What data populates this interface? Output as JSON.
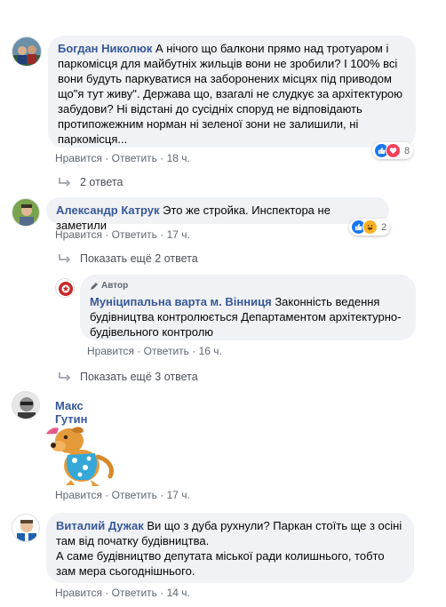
{
  "comments": [
    {
      "author": "Богдан Николюк",
      "text": "А нічого що балкони прямо над тротуаром і паркомісця для майбутніх жильців вони не зробили? І 100% всі вони будуть паркуватися на заборонених місцях під приводом що\"я тут живу\". Держава що, взагалі не слудкує за архітектурою забудови? Ні відстані до сусідніх споруд не відповідають протипожежним норман ні зеленої зони не залишили, ні паркомісця...",
      "like": "Нравится",
      "reply": "Ответить",
      "time": "18 ч.",
      "reaction_count": "8",
      "replies_link": "2 ответа"
    },
    {
      "author": "Александр Катрук",
      "text": "Это же стройка. Инспектора не заметили",
      "like": "Нравится",
      "reply": "Ответить",
      "time": "17 ч.",
      "reaction_count": "2",
      "more_replies": "Показать ещё 2 ответа"
    },
    {
      "author_badge": "Автор",
      "author": "Муніципальна варта м. Вінниця",
      "text": "Законність ведення будівництва контролюється Департаментом архітектурно-будівельного контролю",
      "like": "Нравится",
      "reply": "Ответить",
      "time": "16 ч.",
      "more_replies": "Показать ещё 3 ответа"
    },
    {
      "author": "Макс Гутин",
      "like": "Нравится",
      "reply": "Ответить",
      "time": "17 ч."
    },
    {
      "author": "Виталий Дужак",
      "text_line1": "Ви що з дуба рухнули? Паркан стоїть ще з осіні там від початку будівництва.",
      "text_line2": "А саме будівництво депутата міської ради колишнього, тобто зам мера сьогоднішнього.",
      "like": "Нравится",
      "reply": "Ответить",
      "time": "14 ч."
    }
  ],
  "separator": " · ",
  "colors": {
    "link": "#385898",
    "bubble": "#f0f2f5",
    "meta": "#606770",
    "like_blue": "#1877f2",
    "love_red": "#f33e58",
    "haha_yellow": "#f7b125"
  }
}
